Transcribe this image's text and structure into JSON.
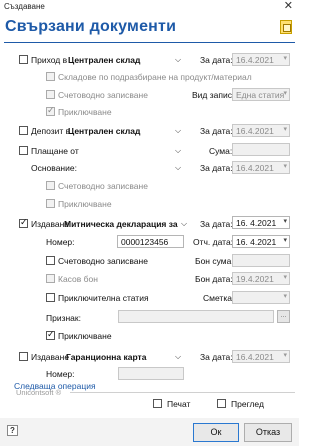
{
  "window": {
    "title": "Създаване",
    "close_glyph": "✕"
  },
  "header": {
    "title": "Свързани документи"
  },
  "receipt": {
    "label": "Приход в",
    "warehouse": "Централен склад",
    "date_label": "За дата:",
    "date": "16.4.2021",
    "default_warehouses": "Складове по подразбиране на продукт/материал",
    "accounting": "Счетоводно записване",
    "entry_type_label": "Вид запис:",
    "entry_type": "Една статия",
    "finalize": "Приключване"
  },
  "deposit": {
    "label": "Депозит в",
    "warehouse": "Централен склад",
    "date_label": "За дата:",
    "date": "16.4.2021"
  },
  "payment": {
    "label": "Плащане от",
    "amount_label": "Сума:",
    "basis_label": "Основание:",
    "date_label": "За дата:",
    "date": "16.4.2021",
    "accounting": "Счетоводно записване",
    "finalize": "Приключване"
  },
  "issue": {
    "label": "Издаване",
    "doc_type": "Митническа декларация за",
    "date_label": "За дата:",
    "date": "16.  4.2021",
    "number_label": "Номер:",
    "number": "0000123456",
    "report_date_label": "Отч. дата:",
    "report_date": "16.  4.2021",
    "accounting": "Счетоводно записване",
    "bon_amount_label": "Бон сума:",
    "cash_receipt": "Касов бон",
    "bon_date_label": "Бон дата:",
    "bon_date": "19.4.2021",
    "closing_entry": "Приключителна статия",
    "account_label": "Сметка:",
    "sign_label": "Признак:",
    "finalize": "Приключване",
    "dots": "..."
  },
  "warranty": {
    "label": "Издаване",
    "doc_type": "Гаранционна карта",
    "date_label": "За дата:",
    "date": "16.4.2021",
    "number_label": "Номер:"
  },
  "next_operation": "Следваща операция",
  "footer": {
    "brand": "Unicontsoft ®",
    "print_label": "Печат",
    "preview_label": "Преглед",
    "ok_label": "Ок",
    "cancel_label": "Отказ",
    "help_glyph": "?"
  },
  "colors": {
    "accent": "#1e5aa8"
  }
}
